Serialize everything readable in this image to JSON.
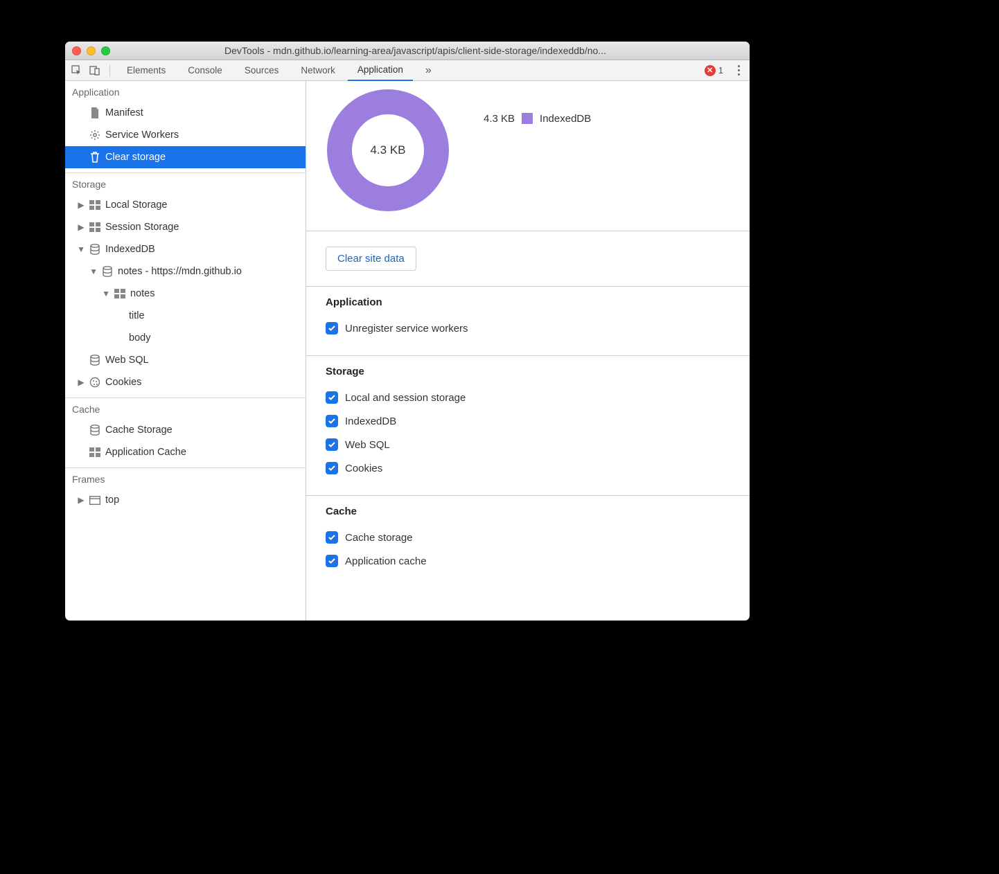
{
  "window": {
    "title": "DevTools - mdn.github.io/learning-area/javascript/apis/client-side-storage/indexeddb/no..."
  },
  "tabs": {
    "elements": "Elements",
    "console": "Console",
    "sources": "Sources",
    "network": "Network",
    "application": "Application",
    "more": "»"
  },
  "errors": {
    "count": "1"
  },
  "sidebar": {
    "sections": {
      "application": {
        "title": "Application",
        "items": {
          "manifest": "Manifest",
          "service_workers": "Service Workers",
          "clear_storage": "Clear storage"
        }
      },
      "storage": {
        "title": "Storage",
        "local_storage": "Local Storage",
        "session_storage": "Session Storage",
        "indexeddb": "IndexedDB",
        "db": "notes - https://mdn.github.io",
        "store": "notes",
        "field_title": "title",
        "field_body": "body",
        "websql": "Web SQL",
        "cookies": "Cookies"
      },
      "cache": {
        "title": "Cache",
        "cache_storage": "Cache Storage",
        "app_cache": "Application Cache"
      },
      "frames": {
        "title": "Frames",
        "top": "top"
      }
    }
  },
  "chart_data": {
    "type": "pie",
    "title": "",
    "center_label": "4.3 KB",
    "series": [
      {
        "name": "IndexedDB",
        "value": 4.3,
        "unit": "KB",
        "display": "4.3 KB",
        "color": "#9b7ede"
      }
    ]
  },
  "clear_button": "Clear site data",
  "groups": {
    "application": {
      "title": "Application",
      "items": {
        "unregister": "Unregister service workers"
      }
    },
    "storage": {
      "title": "Storage",
      "items": {
        "local_session": "Local and session storage",
        "indexeddb": "IndexedDB",
        "websql": "Web SQL",
        "cookies": "Cookies"
      }
    },
    "cache": {
      "title": "Cache",
      "items": {
        "cache_storage": "Cache storage",
        "app_cache": "Application cache"
      }
    }
  }
}
